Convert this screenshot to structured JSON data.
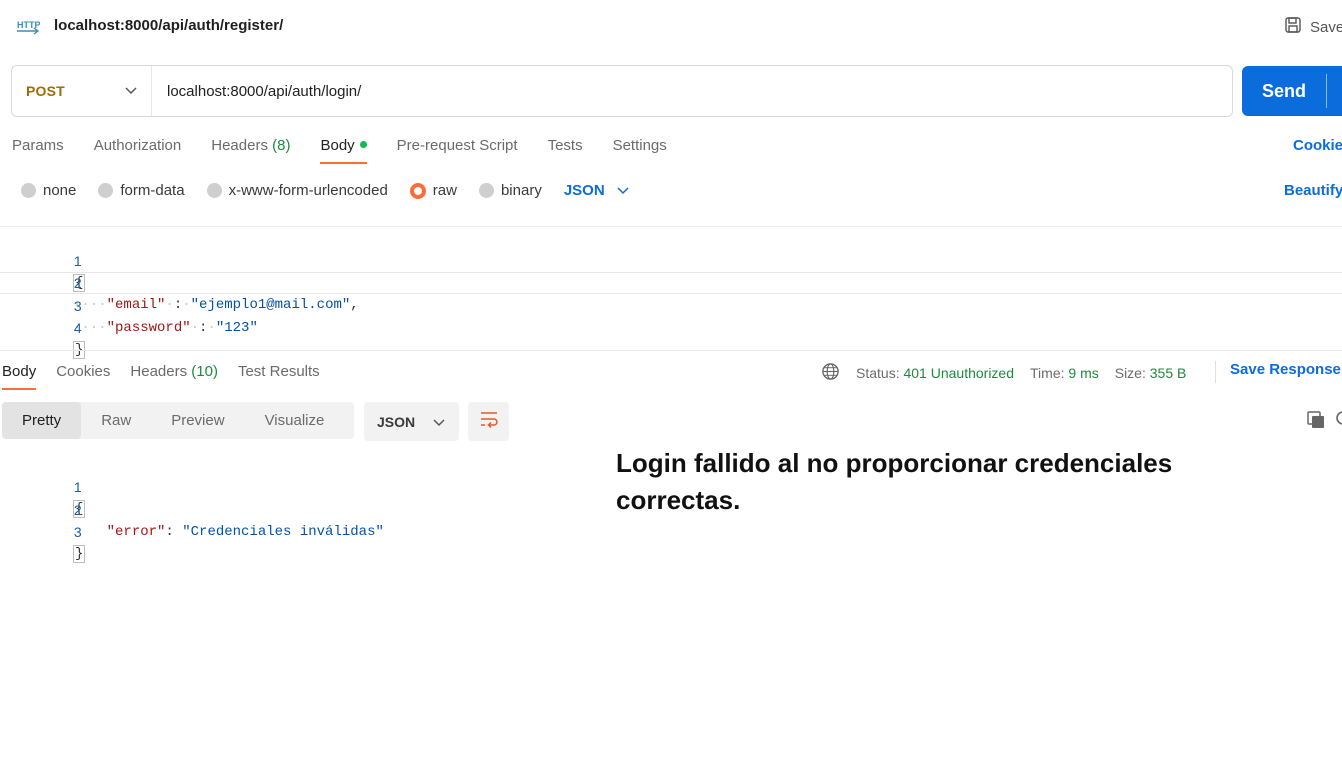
{
  "header": {
    "request_name": "localhost:8000/api/auth/register/",
    "save_label": "Save",
    "http_icon": "http-icon"
  },
  "request": {
    "method": "POST",
    "url": "localhost:8000/api/auth/login/",
    "send_label": "Send"
  },
  "request_tabs": [
    {
      "label": "Params"
    },
    {
      "label": "Authorization"
    },
    {
      "label": "Headers",
      "count": "(8)"
    },
    {
      "label": "Body",
      "active": true
    },
    {
      "label": "Pre-request Script"
    },
    {
      "label": "Tests"
    },
    {
      "label": "Settings"
    }
  ],
  "cookies_label": "Cookies",
  "body_types": [
    {
      "label": "none"
    },
    {
      "label": "form-data"
    },
    {
      "label": "x-www-form-urlencoded"
    },
    {
      "label": "raw",
      "selected": true
    },
    {
      "label": "binary"
    }
  ],
  "body_format": "JSON",
  "beautify_label": "Beautify",
  "request_body_lines": [
    {
      "n": "1",
      "text": "{"
    },
    {
      "n": "2",
      "text": "\"email\" : \"ejemplo1@mail.com\","
    },
    {
      "n": "3",
      "text": "\"password\" : \"123\""
    },
    {
      "n": "4",
      "text": "}"
    }
  ],
  "response_tabs": [
    {
      "label": "Body",
      "active": true
    },
    {
      "label": "Cookies"
    },
    {
      "label": "Headers",
      "count": "(10)"
    },
    {
      "label": "Test Results"
    }
  ],
  "response_status": {
    "status_label": "Status:",
    "status_value": "401 Unauthorized",
    "time_label": "Time:",
    "time_value": "9 ms",
    "size_label": "Size:",
    "size_value": "355 B"
  },
  "save_response_label": "Save Response",
  "view_modes": [
    {
      "label": "Pretty",
      "active": true
    },
    {
      "label": "Raw"
    },
    {
      "label": "Preview"
    },
    {
      "label": "Visualize"
    }
  ],
  "response_format": "JSON",
  "response_body_lines": [
    {
      "n": "1",
      "text": "{"
    },
    {
      "n": "2",
      "text": "\"error\": \"Credenciales inválidas\""
    },
    {
      "n": "3",
      "text": "}"
    }
  ],
  "annotation": "Login fallido al no proporcionar credenciales correctas.",
  "colors": {
    "accent": "#ff6c37",
    "primary": "#0b6cdc",
    "success": "#1e8a3e",
    "method": "#a26b00"
  }
}
